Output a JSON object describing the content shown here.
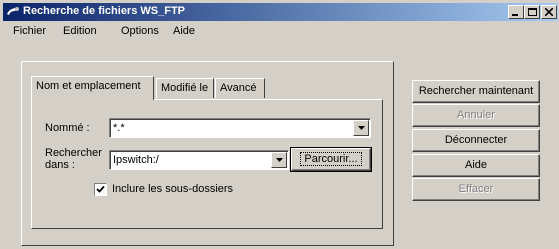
{
  "window": {
    "title": "Recherche de fichiers WS_FTP",
    "controls": {
      "minimize": "minimize-icon",
      "maximize": "maximize-icon",
      "close": "close-icon"
    }
  },
  "menu": {
    "items": [
      {
        "label": "Fichier"
      },
      {
        "label": "Edition"
      },
      {
        "label": "Options"
      },
      {
        "label": "Aide"
      }
    ]
  },
  "tabs": [
    {
      "label": "Nom et emplacement",
      "active": true
    },
    {
      "label": "Modifié le",
      "active": false
    },
    {
      "label": "Avancé",
      "active": false
    }
  ],
  "form": {
    "named_label": "Nommé :",
    "named_value": "*.*",
    "search_in_label_line1": "Rechercher",
    "search_in_label_line2": "dans :",
    "search_in_value": "Ipswitch:/",
    "browse_label": "Parcourir...",
    "include_subfolders_label": "Inclure les sous-dossiers",
    "include_subfolders_checked": true
  },
  "actions": {
    "search_now": "Rechercher maintenant",
    "cancel": "Annuler",
    "disconnect": "Déconnecter",
    "help": "Aide",
    "clear": "Effacer"
  },
  "colors": {
    "face": "#d4d0c8",
    "title_start": "#0a246a",
    "title_end": "#a6caf0",
    "disabled_text": "#808080"
  }
}
